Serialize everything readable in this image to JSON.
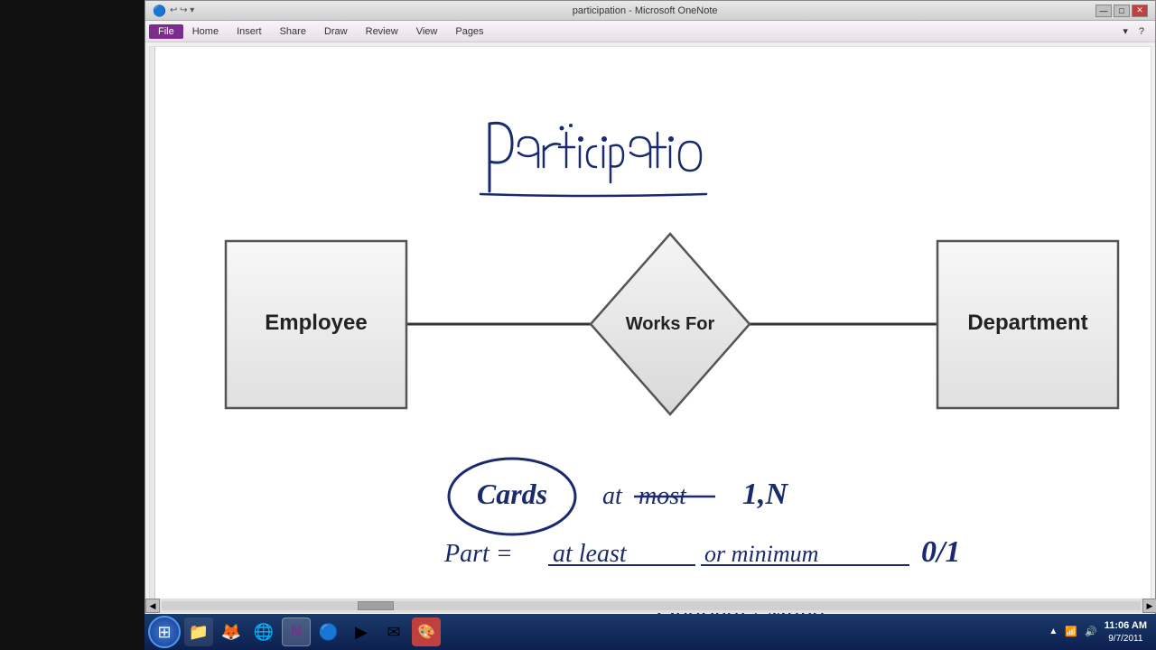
{
  "window": {
    "title": "participation - Microsoft OneNote",
    "controls": [
      "—",
      "□",
      "✕"
    ]
  },
  "menubar": {
    "items": [
      "File",
      "Home",
      "Insert",
      "Share",
      "Draw",
      "Review",
      "View",
      "Pages"
    ],
    "active": "File",
    "help": "?"
  },
  "diagram": {
    "title": "Participation",
    "entities": {
      "employee": "Employee",
      "department": "Department",
      "relationship": "Works For"
    }
  },
  "notes": {
    "line1": "Card = at most   1,N",
    "line2": "Part = at least or minimum   0/1",
    "line3": "Optional / Mand."
  },
  "taskbar": {
    "time": "11:06 AM",
    "date": "9/7/2011"
  }
}
